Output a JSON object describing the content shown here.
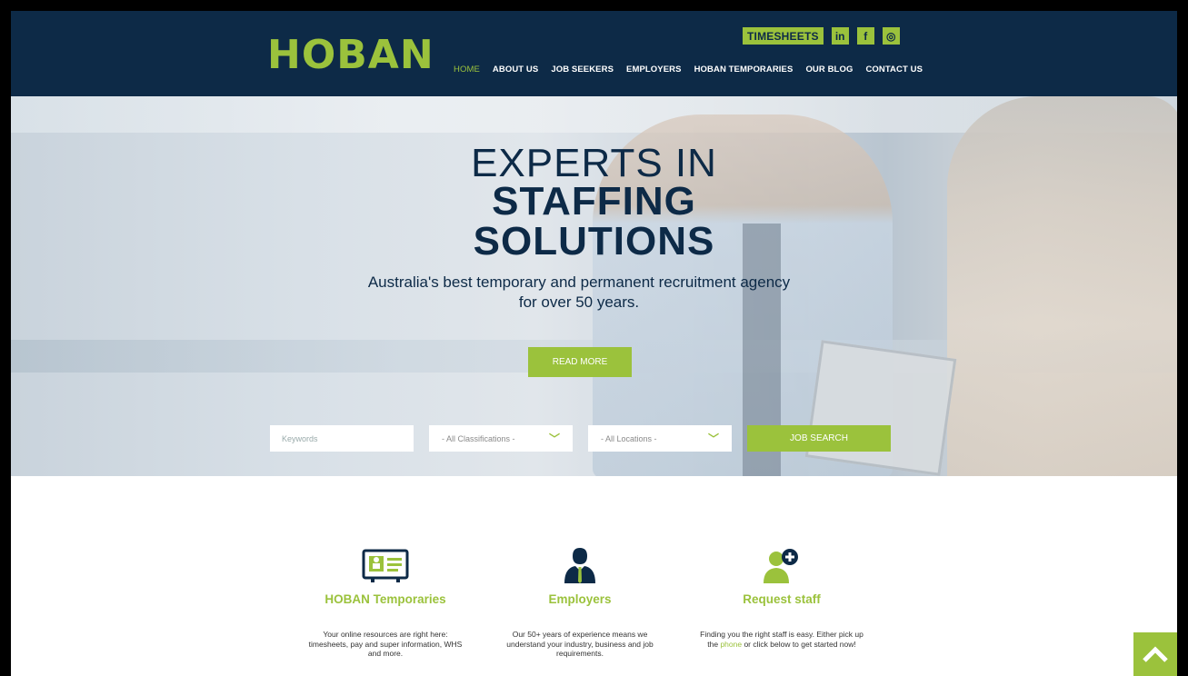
{
  "header": {
    "logo": "HOBAN",
    "timesheets": "TIMESHEETS",
    "social": [
      {
        "icon": "linkedin-icon",
        "glyph": "in"
      },
      {
        "icon": "facebook-icon",
        "glyph": "f"
      },
      {
        "icon": "instagram-icon",
        "glyph": "◎"
      }
    ],
    "nav": [
      "HOME",
      "ABOUT US",
      "JOB SEEKERS",
      "EMPLOYERS",
      "HOBAN TEMPORARIES",
      "OUR BLOG",
      "CONTACT US"
    ]
  },
  "hero": {
    "line1": "EXPERTS IN",
    "line2": "STAFFING",
    "line3": "SOLUTIONS",
    "subtitle": "Australia's best temporary and permanent recruitment agency for over 50 years.",
    "read_more": "READ MORE"
  },
  "search": {
    "keywords_placeholder": "Keywords",
    "classifications": "- All Classifications -",
    "locations": "- All Locations -",
    "button": "JOB SEARCH"
  },
  "features": [
    {
      "title": "HOBAN Temporaries",
      "desc": "Your online resources are right here: timesheets, pay and super information, WHS and more."
    },
    {
      "title": "Employers",
      "desc": "Our 50+ years of experience means we understand your industry, business and job requirements."
    },
    {
      "title": "Request staff",
      "desc_pre": "Finding you the right staff is easy. Either pick up the ",
      "desc_link": "phone",
      "desc_post": " or click below to get started now!"
    }
  ],
  "colors": {
    "navy": "#0d2a47",
    "green": "#9bc23c"
  }
}
